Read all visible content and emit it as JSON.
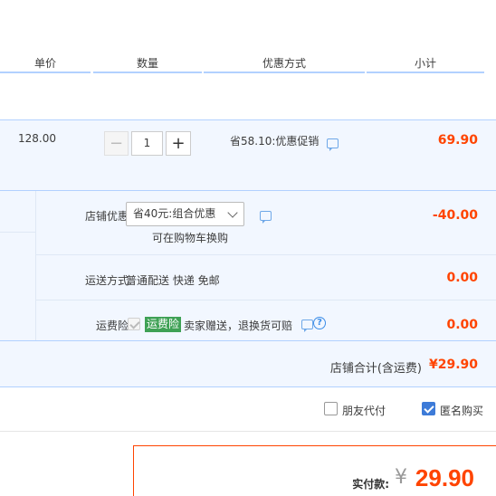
{
  "header": {
    "unit_price": "单价",
    "quantity": "数量",
    "promotion": "优惠方式",
    "subtotal": "小计"
  },
  "item": {
    "price": "128.00",
    "quantity": "1",
    "minus": "−",
    "plus": "+",
    "promotion": "省58.10:优惠促销",
    "subtotal": "69.90"
  },
  "shop": {
    "discount_label": "店铺优惠:",
    "discount_select": "省40元:组合优惠",
    "discount_hint": "可在购物车换购",
    "discount_value": "-40.00",
    "shipping_label": "运送方式:",
    "shipping_text": "普通配送 快递 免邮",
    "shipping_value": "0.00",
    "insurance_label": "运费险:",
    "insurance_tag": "运费险",
    "insurance_text": "卖家赠送，退换货可赔",
    "insurance_value": "0.00",
    "total_label": "店铺合计(含运费)",
    "total_value": "¥29.90"
  },
  "options": {
    "friend_pay": "朋友代付",
    "friend_pay_checked": false,
    "anonymous": "匿名购买",
    "anonymous_checked": true
  },
  "payment": {
    "label": "实付款:",
    "currency": "¥",
    "amount": "29.90"
  },
  "colors": {
    "accent_red": "#ff4400",
    "accent_blue": "#3d7bd8",
    "tag_green": "#3fa155",
    "row_bg": "#f2f7ff"
  }
}
